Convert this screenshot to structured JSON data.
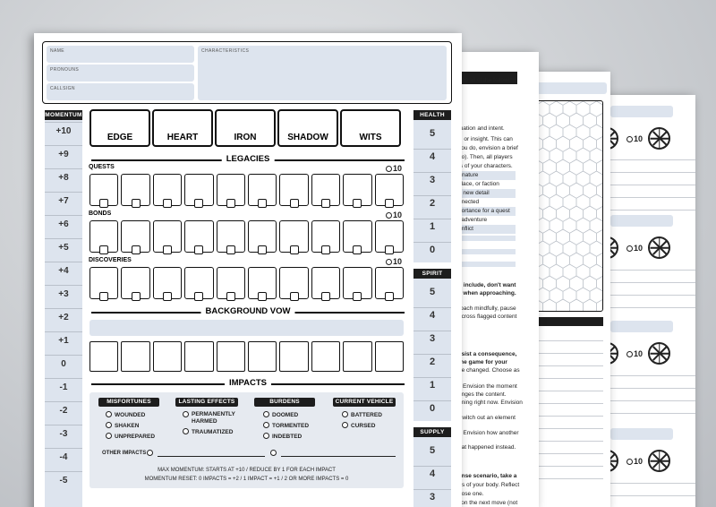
{
  "fields": {
    "name": "NAME",
    "pronouns": "PRONOUNS",
    "callsign": "CALLSIGN",
    "characteristics": "CHARACTERISTICS"
  },
  "momentum": {
    "label": "MOMENTUM",
    "values": [
      "+10",
      "+9",
      "+8",
      "+7",
      "+6",
      "+5",
      "+4",
      "+3",
      "+2",
      "+1",
      "0",
      "-1",
      "-2",
      "-3",
      "-4",
      "-5"
    ]
  },
  "stats": [
    "EDGE",
    "HEART",
    "IRON",
    "SHADOW",
    "WITS"
  ],
  "legacies": {
    "title": "LEGACIES",
    "quests": "QUESTS",
    "bonds": "BONDS",
    "discoveries": "DISCOVERIES",
    "ten": "10"
  },
  "background_vow": "BACKGROUND VOW",
  "tracks": {
    "health": {
      "label": "HEALTH",
      "values": [
        "5",
        "4",
        "3",
        "2",
        "1",
        "0"
      ]
    },
    "spirit": {
      "label": "SPIRIT",
      "values": [
        "5",
        "4",
        "3",
        "2",
        "1",
        "0"
      ]
    },
    "supply": {
      "label": "SUPPLY",
      "values": [
        "5",
        "4",
        "3"
      ]
    }
  },
  "impacts": {
    "title": "IMPACTS",
    "groups": [
      {
        "head": "MISFORTUNES",
        "items": [
          "WOUNDED",
          "SHAKEN",
          "UNPREPARED"
        ]
      },
      {
        "head": "LASTING EFFECTS",
        "items": [
          "PERMANENTLY HARMED",
          "TRAUMATIZED"
        ]
      },
      {
        "head": "BURDENS",
        "items": [
          "DOOMED",
          "TORMENTED",
          "INDEBTED"
        ]
      },
      {
        "head": "CURRENT VEHICLE",
        "items": [
          "BATTERED",
          "CURSED"
        ]
      }
    ],
    "other": "OTHER IMPACTS",
    "rule1": "MAX MOMENTUM:  STARTS AT +10   /   REDUCE BY 1 FOR EACH IMPACT",
    "rule2": "MOMENTUM RESET:  0 IMPACTS = +2   /   1 IMPACT = +1   /   2 OR MORE IMPACTS = 0"
  },
  "back_page_text": [
    ", do all of the following.",
    "tuation and intent.",
    "y, or insight. This can",
    "you do, envision a brief",
    "do). Then, all players",
    "ts of your characters.",
    "r nature",
    "place, or faction",
    "n new detail",
    "nnected",
    "portance for a quest",
    "sadventure",
    "onflict",
    "o include, don't want",
    "s when approaching.",
    "roach mindfully, pause",
    "across flagged content",
    "esist a consequence,",
    "the game for your",
    "be changed. Choose as",
    "l. Envision the moment",
    "anges the content.",
    "ening right now. Envision",
    "Switch out an element",
    "t. Envision how another",
    "hat happened instead.",
    "ense scenario, take a",
    "rts of your body. Reflect",
    "hose one.",
    "l on the next move (not"
  ],
  "vehicle_ten": "10"
}
